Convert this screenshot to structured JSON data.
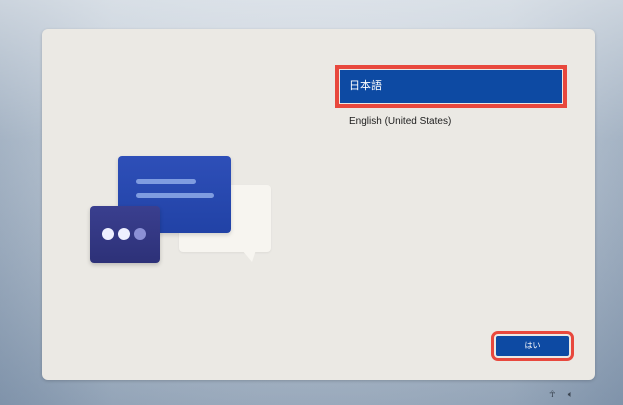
{
  "setup": {
    "language_options": [
      {
        "label": "日本語",
        "selected": true
      },
      {
        "label": "English (United States)",
        "selected": false
      }
    ],
    "yes_button_label": "はい"
  },
  "tray": {
    "accessibility_icon": "accessibility-icon",
    "volume_icon": "volume-icon"
  },
  "colors": {
    "accent": "#0d4aa3",
    "highlight": "#e8483d",
    "window_bg": "#ebe9e4"
  }
}
